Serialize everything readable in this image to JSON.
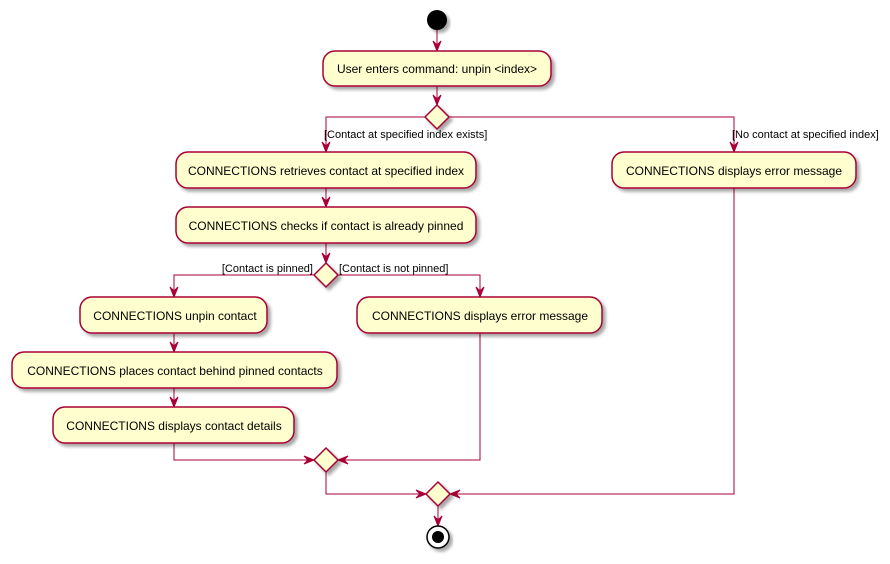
{
  "diagram": {
    "type": "activity",
    "colors": {
      "activity_fill": "#FEFECE",
      "border": "#A80036",
      "edge": "#A80036",
      "start_fill": "#000000",
      "shadow": "#C8C8C8"
    },
    "nodes": {
      "start": {
        "kind": "start"
      },
      "enter_command": {
        "kind": "activity",
        "label": "User enters command: unpin <index>"
      },
      "decision_exists": {
        "kind": "decision"
      },
      "retrieve_contact": {
        "kind": "activity",
        "label": "CONNECTIONS retrieves contact at specified index"
      },
      "check_pinned": {
        "kind": "activity",
        "label": "CONNECTIONS checks if contact is already pinned"
      },
      "decision_pinned": {
        "kind": "decision"
      },
      "unpin_contact": {
        "kind": "activity",
        "label": "CONNECTIONS unpin contact"
      },
      "place_behind": {
        "kind": "activity",
        "label": "CONNECTIONS places contact behind pinned contacts"
      },
      "display_details": {
        "kind": "activity",
        "label": "CONNECTIONS displays contact details"
      },
      "error_not_pinned": {
        "kind": "activity",
        "label": "CONNECTIONS displays error message"
      },
      "error_no_contact": {
        "kind": "activity",
        "label": "CONNECTIONS displays error message"
      },
      "merge_pinned": {
        "kind": "merge"
      },
      "merge_exists": {
        "kind": "merge"
      },
      "end": {
        "kind": "end"
      }
    },
    "guards": {
      "contact_exists": "[Contact at specified index exists]",
      "no_contact": "[No contact at specified index]",
      "is_pinned": "[Contact is pinned]",
      "not_pinned": "[Contact is not pinned]"
    },
    "edges": [
      {
        "from": "start",
        "to": "enter_command"
      },
      {
        "from": "enter_command",
        "to": "decision_exists"
      },
      {
        "from": "decision_exists",
        "to": "retrieve_contact",
        "guard": "contact_exists"
      },
      {
        "from": "decision_exists",
        "to": "error_no_contact",
        "guard": "no_contact"
      },
      {
        "from": "retrieve_contact",
        "to": "check_pinned"
      },
      {
        "from": "check_pinned",
        "to": "decision_pinned"
      },
      {
        "from": "decision_pinned",
        "to": "unpin_contact",
        "guard": "is_pinned"
      },
      {
        "from": "decision_pinned",
        "to": "error_not_pinned",
        "guard": "not_pinned"
      },
      {
        "from": "unpin_contact",
        "to": "place_behind"
      },
      {
        "from": "place_behind",
        "to": "display_details"
      },
      {
        "from": "display_details",
        "to": "merge_pinned"
      },
      {
        "from": "error_not_pinned",
        "to": "merge_pinned"
      },
      {
        "from": "merge_pinned",
        "to": "merge_exists"
      },
      {
        "from": "error_no_contact",
        "to": "merge_exists"
      },
      {
        "from": "merge_exists",
        "to": "end"
      }
    ]
  }
}
